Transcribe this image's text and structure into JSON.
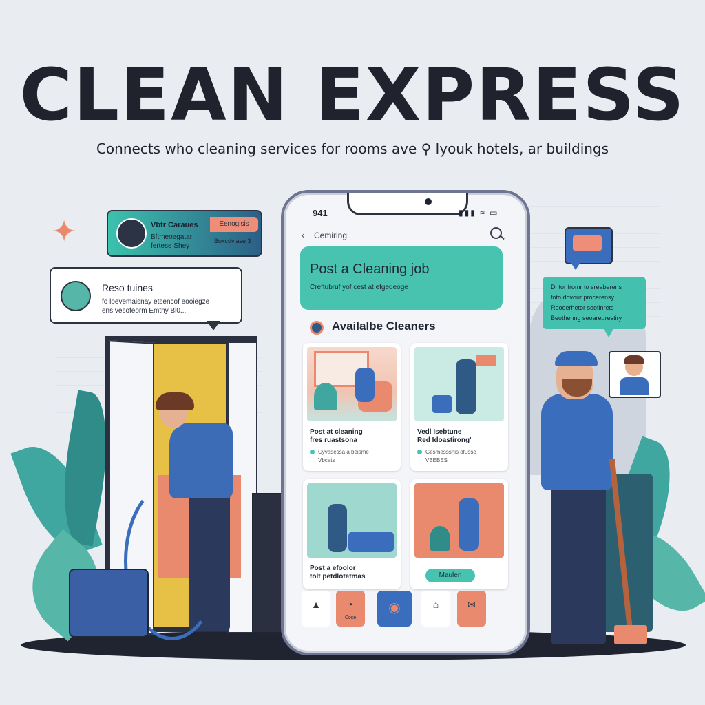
{
  "brand": {
    "title": "CLEAN EXPRESS",
    "tagline": "Connects who cleaning services for rooms ave ⚲ lyouk hotels, ar buildings"
  },
  "bubbles": {
    "top": {
      "name": "Vbtr Caraues",
      "line1": "Bftmeoegatar",
      "line2": "fertese Shey",
      "tag": "Eenogisis",
      "tag2": "Boxcdvlase 3"
    },
    "middle": {
      "name": "Reso tuines",
      "line1": "fo loevemaisnay etsencof eooiegze",
      "line2": "ens vesofeorm Emtny Bl0..."
    },
    "right": {
      "lines": [
        "Dntor fromr to sreaberens",
        "foto dovour procerensy",
        "Reoeerhetor sootinrets",
        "Beothenng seoaredrestiry"
      ]
    }
  },
  "phone": {
    "time": "941",
    "status_icons": "▮▮▮ ≈ ▭",
    "back_label": "Cemiring",
    "post_card": {
      "title": "Post a Cleaning job",
      "subtitle": "Creftubruf yof cest at efgedeoge"
    },
    "section_title": "Availalbe Cleaners",
    "cards": [
      {
        "line1": "Post at cleaning",
        "line2": "fres ruastsona",
        "meta": "Cyvasessa a beisme",
        "meta2": "Vbcets"
      },
      {
        "line1": "Vedl Isebtune",
        "line2": "Red Idoastirong'",
        "meta": "Gesmesssnis ofusse",
        "meta2": "VBEBES"
      },
      {
        "line1": "Post a efoolor",
        "line2": "tolt petdlotetmas",
        "meta": "",
        "meta2": ""
      },
      {
        "pill": "Maulen"
      }
    ],
    "nav": [
      {
        "glyph": "▲",
        "label": ""
      },
      {
        "glyph": "◔",
        "label": "Cose"
      },
      {
        "glyph": "◉",
        "label": ""
      },
      {
        "glyph": "⌂",
        "label": ""
      },
      {
        "glyph": "✉",
        "label": ""
      }
    ]
  },
  "icons": {
    "sparkle": "sparkle-icon",
    "search": "search-icon",
    "back": "back-chevron-icon"
  },
  "colors": {
    "teal": "#47c3b0",
    "coral": "#e98a6e",
    "navy": "#2b3a5c",
    "blue": "#3a6ebd",
    "background": "#e9edf2"
  }
}
